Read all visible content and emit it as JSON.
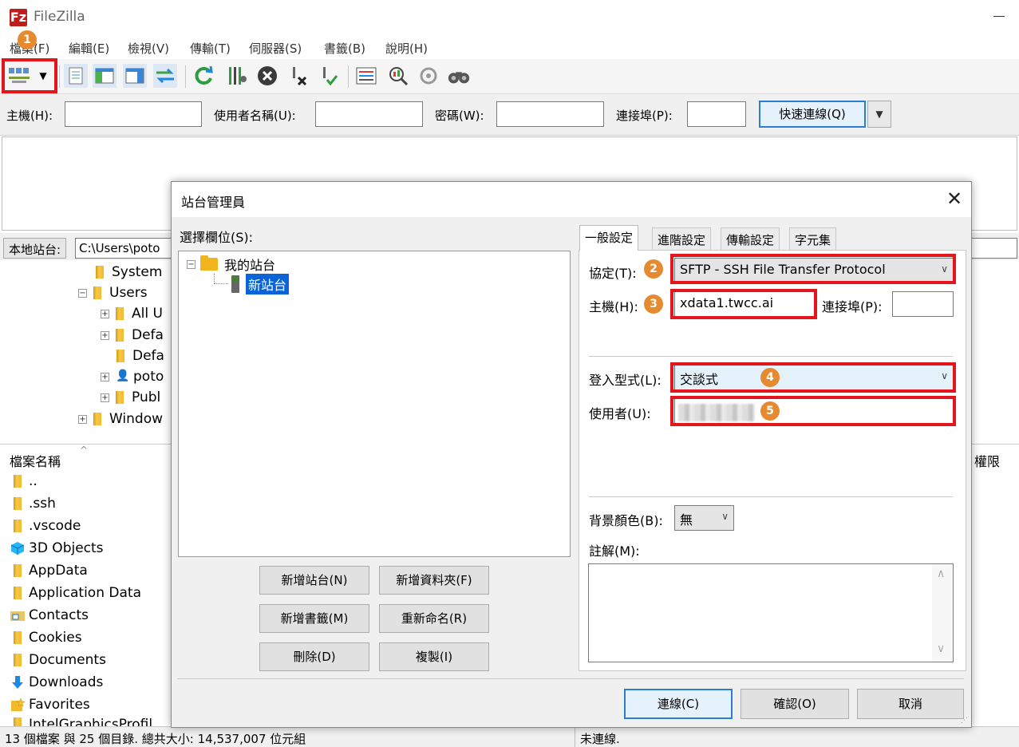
{
  "app": {
    "logo_letter": "Fz",
    "title": "FileZilla",
    "colors": {
      "annotation_red": "#e3161d",
      "badge_orange": "#e58a31",
      "selection_blue": "#0a64d8"
    }
  },
  "menu": [
    "檔案(F)",
    "編輯(E)",
    "檢視(V)",
    "傳輸(T)",
    "伺服器(S)",
    "書籤(B)",
    "說明(H)"
  ],
  "toolbar": {
    "icons": [
      "site-manager-icon",
      "dropdown-icon",
      "message-log-icon",
      "local-tree-icon",
      "remote-tree-icon",
      "transfer-queue-icon",
      "refresh-icon",
      "process-queue-icon",
      "cancel-icon",
      "disconnect-icon",
      "reconnect-icon",
      "filter-icon",
      "compare-icon",
      "sync-browse-icon",
      "search-icon"
    ]
  },
  "quickconnect": {
    "host_label": "主機(H):",
    "user_label": "使用者名稱(U):",
    "pass_label": "密碼(W):",
    "port_label": "連接埠(P):",
    "connect_label": "快速連線(Q)"
  },
  "local": {
    "label": "本地站台:",
    "path": "C:\\Users\\poto",
    "tree": [
      {
        "label": "System",
        "expander": ""
      },
      {
        "label": "Users",
        "expander": "−"
      },
      {
        "label": "All U",
        "expander": "+"
      },
      {
        "label": "Defa",
        "expander": "+"
      },
      {
        "label": "Defa",
        "expander": ""
      },
      {
        "label": "poto",
        "expander": "+"
      },
      {
        "label": "Publ",
        "expander": "+"
      },
      {
        "label": "Window",
        "expander": "+"
      }
    ]
  },
  "filelist": {
    "col_name": "檔案名稱",
    "col_perm": "權限",
    "files": [
      "..",
      ".ssh",
      ".vscode",
      "3D Objects",
      "AppData",
      "Application Data",
      "Contacts",
      "Cookies",
      "Documents",
      "Downloads",
      "Favorites",
      "IntelGraphicsProfil"
    ]
  },
  "status": {
    "left": "13 個檔案 與 25 個目錄. 總共大小: 14,537,007 位元組",
    "right": "未連線."
  },
  "dialog": {
    "title": "站台管理員",
    "select_label": "選擇欄位(S):",
    "tree_root": "我的站台",
    "tree_site": "新站台",
    "buttons": {
      "new_site": "新增站台(N)",
      "new_folder": "新增資料夾(F)",
      "new_bookmark": "新增書籤(M)",
      "rename": "重新命名(R)",
      "delete": "刪除(D)",
      "copy": "複製(I)",
      "connect": "連線(C)",
      "ok": "確認(O)",
      "cancel": "取消"
    },
    "tabs": [
      "一般設定",
      "進階設定",
      "傳輸設定",
      "字元集"
    ],
    "form": {
      "protocol_label": "協定(T):",
      "protocol_value": "SFTP - SSH File Transfer Protocol",
      "host_label": "主機(H):",
      "host_value": "xdata1.twcc.ai",
      "port_label": "連接埠(P):",
      "logon_label": "登入型式(L):",
      "logon_value": "交談式",
      "user_label": "使用者(U):",
      "bgcolor_label": "背景顏色(B):",
      "bgcolor_value": "無",
      "comment_label": "註解(M):"
    },
    "badges": [
      "1",
      "2",
      "3",
      "4",
      "5"
    ]
  }
}
